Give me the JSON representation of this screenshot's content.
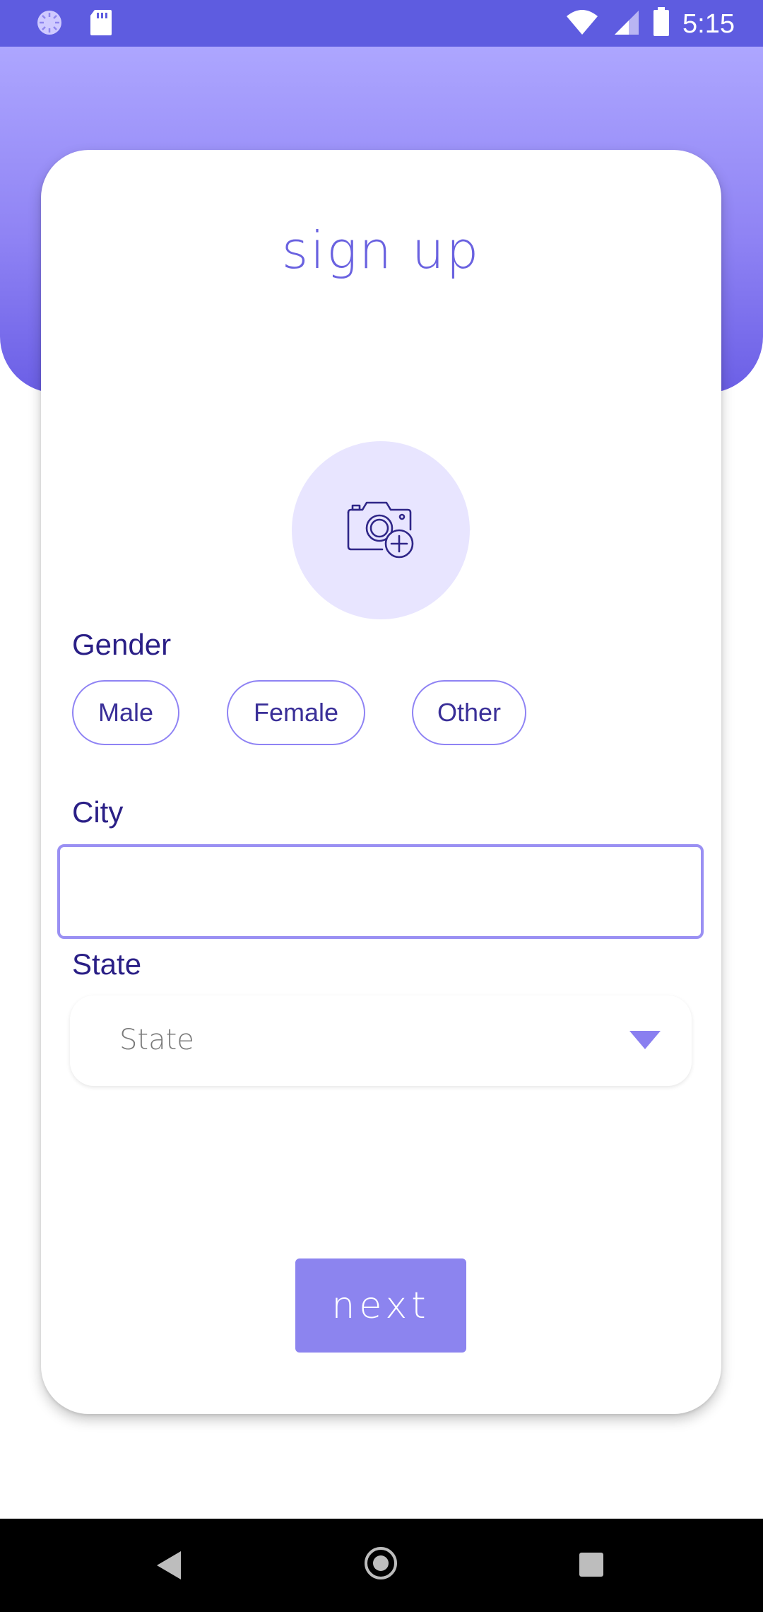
{
  "status_bar": {
    "time": "5:15",
    "icons": [
      "loading-icon",
      "sd-card-icon",
      "wifi-icon",
      "signal-icon",
      "battery-icon"
    ]
  },
  "form": {
    "title": "sign up",
    "photo_icon": "camera-add-icon",
    "gender_label": "Gender",
    "gender_options": [
      "Male",
      "Female",
      "Other"
    ],
    "city_label": "City",
    "city_value": "",
    "state_label": "State",
    "state_placeholder": "State",
    "next_label": "next"
  },
  "colors": {
    "status_bar": "#5e5ce0",
    "accent": "#8c84ef",
    "label_text": "#2a1f86",
    "photo_bg": "#e8e5ff"
  },
  "nav_bar": {
    "icons": [
      "back-icon",
      "home-icon",
      "recent-apps-icon"
    ]
  }
}
